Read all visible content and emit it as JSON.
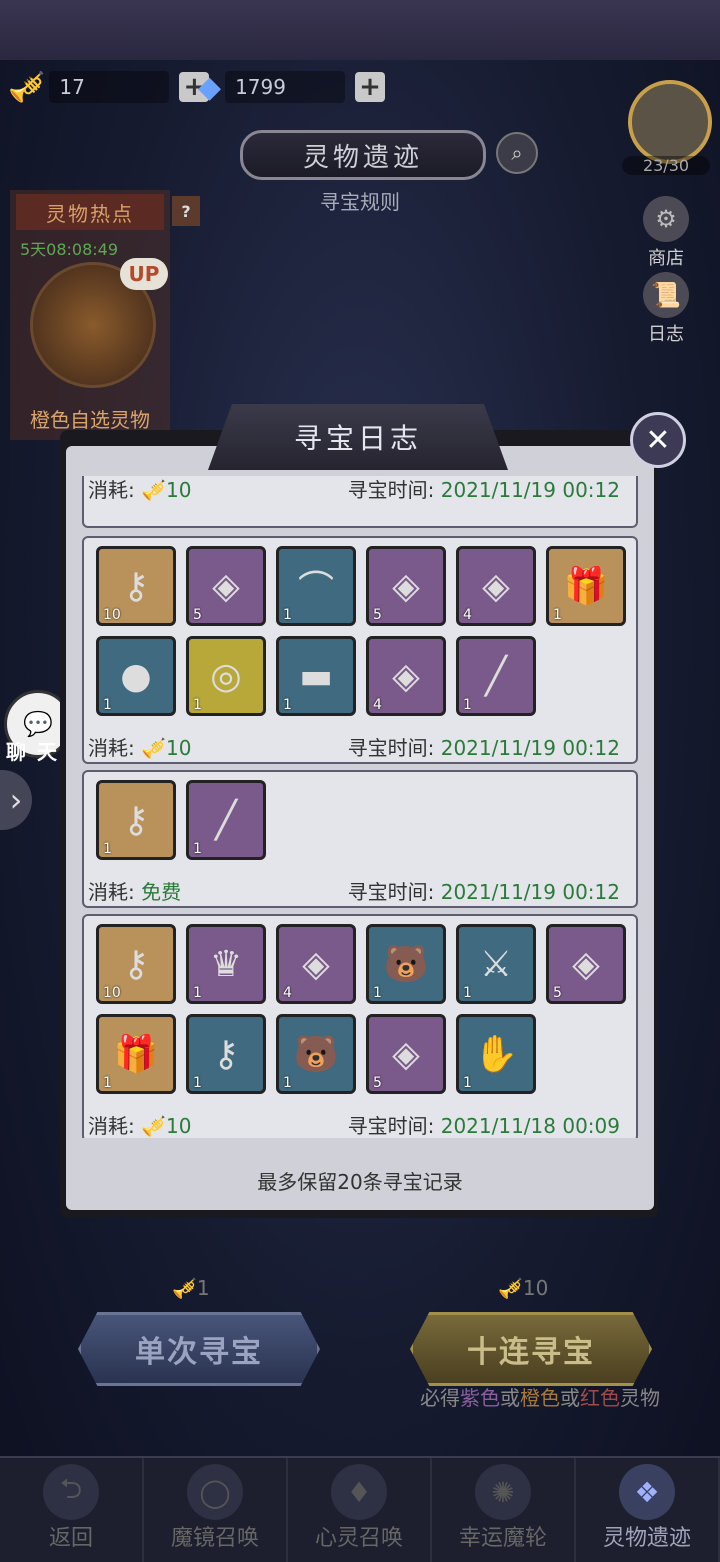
{
  "resources": {
    "horn_count": "17",
    "diamond_count": "1799",
    "plus": "+"
  },
  "header": {
    "title": "灵物遗迹",
    "rules": "寻宝规则",
    "search_icon": "magnifier-icon"
  },
  "avatar": {
    "count": "23/30"
  },
  "side": {
    "shop": "商店",
    "log": "日志"
  },
  "hot": {
    "title": "灵物热点",
    "help": "?",
    "timer": "5天08:08:49",
    "up": "UP",
    "label": "橙色自选灵物"
  },
  "chat": {
    "label": "聊 天"
  },
  "modal": {
    "title": "寻宝日志",
    "close": "✕",
    "cost_label": "消耗",
    "time_label": "寻宝时间",
    "keep_note": "最多保留20条寻宝记录",
    "partial_record": {
      "cost": "10",
      "time": "2021/11/19 00:12"
    },
    "records": [
      {
        "cost": "10",
        "time": "2021/11/19 00:12",
        "items": [
          {
            "icon": "⚷",
            "type": "gold",
            "qty": "10"
          },
          {
            "icon": "◈",
            "type": "purple",
            "qty": "5"
          },
          {
            "icon": "⌒",
            "type": "blue",
            "qty": "1"
          },
          {
            "icon": "◈",
            "type": "purple",
            "qty": "5"
          },
          {
            "icon": "◈",
            "type": "purple",
            "qty": "4"
          },
          {
            "icon": "🎁",
            "type": "gold",
            "qty": "1"
          },
          {
            "icon": "●",
            "type": "blue",
            "qty": "1"
          },
          {
            "icon": "◎",
            "type": "yellow",
            "qty": "1"
          },
          {
            "icon": "▬",
            "type": "blue",
            "qty": "1"
          },
          {
            "icon": "◈",
            "type": "purple",
            "qty": "4"
          },
          {
            "icon": "╱",
            "type": "purple",
            "qty": "1"
          }
        ]
      },
      {
        "cost": "免费",
        "time": "2021/11/19 00:12",
        "items": [
          {
            "icon": "⚷",
            "type": "gold",
            "qty": "1"
          },
          {
            "icon": "╱",
            "type": "purple",
            "qty": "1"
          }
        ]
      },
      {
        "cost": "10",
        "time": "2021/11/18 00:09",
        "items": [
          {
            "icon": "⚷",
            "type": "gold",
            "qty": "10"
          },
          {
            "icon": "♛",
            "type": "purple",
            "qty": "1"
          },
          {
            "icon": "◈",
            "type": "purple",
            "qty": "4"
          },
          {
            "icon": "🐻",
            "type": "blue",
            "qty": "1"
          },
          {
            "icon": "⚔",
            "type": "blue",
            "qty": "1"
          },
          {
            "icon": "◈",
            "type": "purple",
            "qty": "5"
          },
          {
            "icon": "🎁",
            "type": "gold",
            "qty": "1"
          },
          {
            "icon": "⚷",
            "type": "blue",
            "qty": "1"
          },
          {
            "icon": "🐻",
            "type": "blue",
            "qty": "1"
          },
          {
            "icon": "◈",
            "type": "purple",
            "qty": "5"
          },
          {
            "icon": "✋",
            "type": "blue",
            "qty": "1"
          }
        ]
      }
    ]
  },
  "bottom": {
    "single_cost": "1",
    "ten_cost": "10",
    "single_label": "单次寻宝",
    "ten_label": "十连寻宝",
    "guarantee_pre": "必得",
    "guarantee_purple": "紫色",
    "guarantee_or1": "或",
    "guarantee_orange": "橙色",
    "guarantee_or2": "或",
    "guarantee_red": "红色",
    "guarantee_post": "灵物"
  },
  "nav": [
    {
      "label": "返回",
      "icon": "back-icon",
      "glyph": "⮌"
    },
    {
      "label": "魔镜召唤",
      "icon": "mirror-icon",
      "glyph": "◯"
    },
    {
      "label": "心灵召唤",
      "icon": "crystal-icon",
      "glyph": "♦"
    },
    {
      "label": "幸运魔轮",
      "icon": "wheel-icon",
      "glyph": "✺"
    },
    {
      "label": "灵物遗迹",
      "icon": "relic-icon",
      "glyph": "❖"
    }
  ]
}
